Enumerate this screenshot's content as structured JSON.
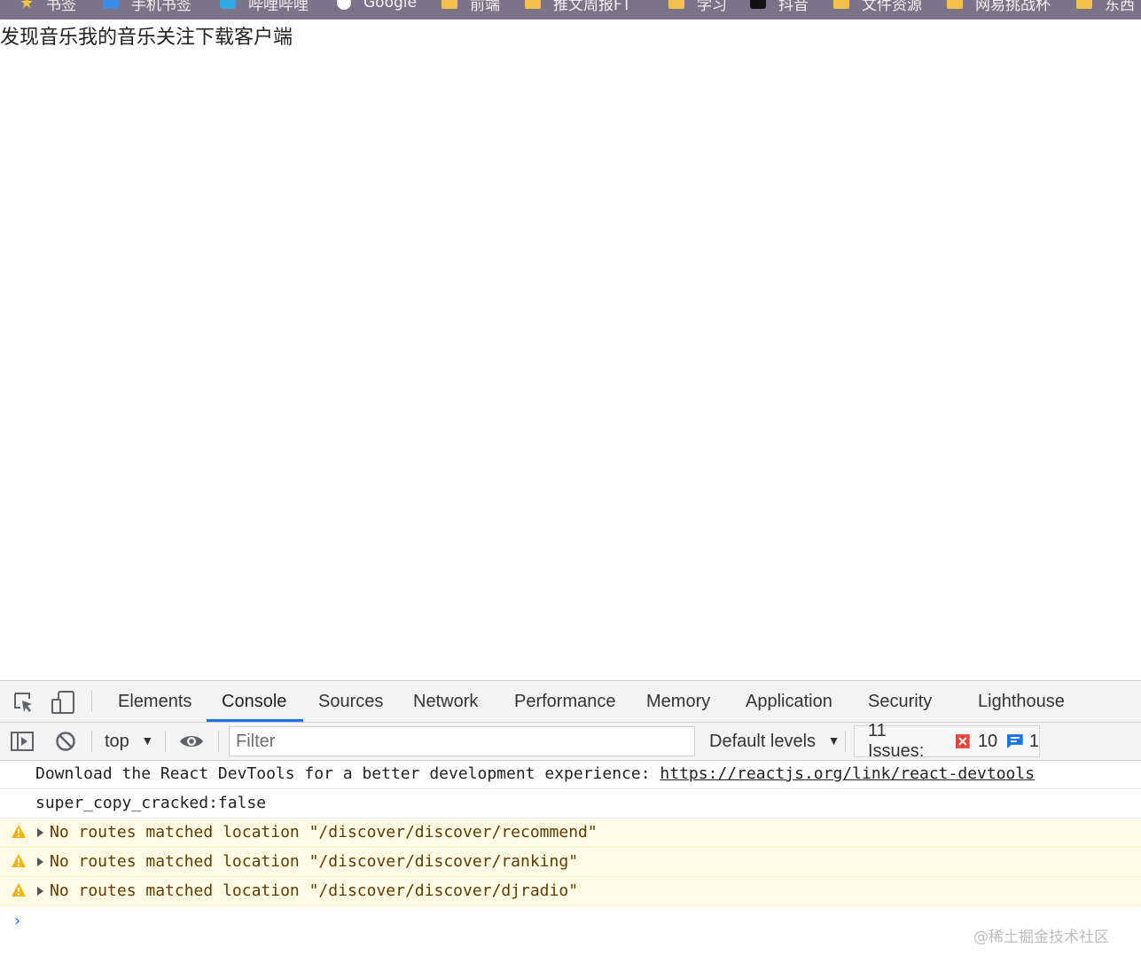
{
  "bookmarks": [
    {
      "label": "书签",
      "icon": "star-icon"
    },
    {
      "label": "手机书签",
      "icon": "phone-bookmark-icon"
    },
    {
      "label": "哔哩哔哩",
      "icon": "bilibili-icon"
    },
    {
      "label": "Google",
      "icon": "google-icon"
    },
    {
      "label": "前端",
      "icon": "folder-icon"
    },
    {
      "label": "推文周报FT",
      "icon": "folder-icon"
    },
    {
      "label": "学习",
      "icon": "folder-icon"
    },
    {
      "label": "抖音",
      "icon": "tiktok-icon"
    },
    {
      "label": "文件资源",
      "icon": "folder-icon"
    },
    {
      "label": "网易挑战杯",
      "icon": "folder-icon"
    },
    {
      "label": "东西",
      "icon": "folder-icon"
    }
  ],
  "page": {
    "nav": [
      "发现音乐",
      "我的音乐",
      "关注",
      "下载客户端"
    ]
  },
  "devtools": {
    "tabs": [
      "Elements",
      "Console",
      "Sources",
      "Network",
      "Performance",
      "Memory",
      "Application",
      "Security",
      "Lighthouse"
    ],
    "active_tab": "Console",
    "toolbar": {
      "context": "top",
      "filter_placeholder": "Filter",
      "levels": "Default levels",
      "issues_label": "11 Issues:",
      "error_count": "10",
      "info_count": "1"
    },
    "messages": [
      {
        "type": "log",
        "text": "Download the React DevTools for a better development experience: ",
        "link": "https://reactjs.org/link/react-devtools"
      },
      {
        "type": "log",
        "text": "super_copy_cracked:false"
      },
      {
        "type": "warning",
        "text": "No routes matched location \"/discover/discover/recommend\""
      },
      {
        "type": "warning",
        "text": "No routes matched location \"/discover/discover/ranking\""
      },
      {
        "type": "warning",
        "text": "No routes matched location \"/discover/discover/djradio\""
      }
    ],
    "prompt": "›"
  },
  "watermark": "@稀土掘金技术社区",
  "colors": {
    "accent": "#1a73e8",
    "warning_bg": "#fffbe5",
    "error": "#e8453c"
  }
}
